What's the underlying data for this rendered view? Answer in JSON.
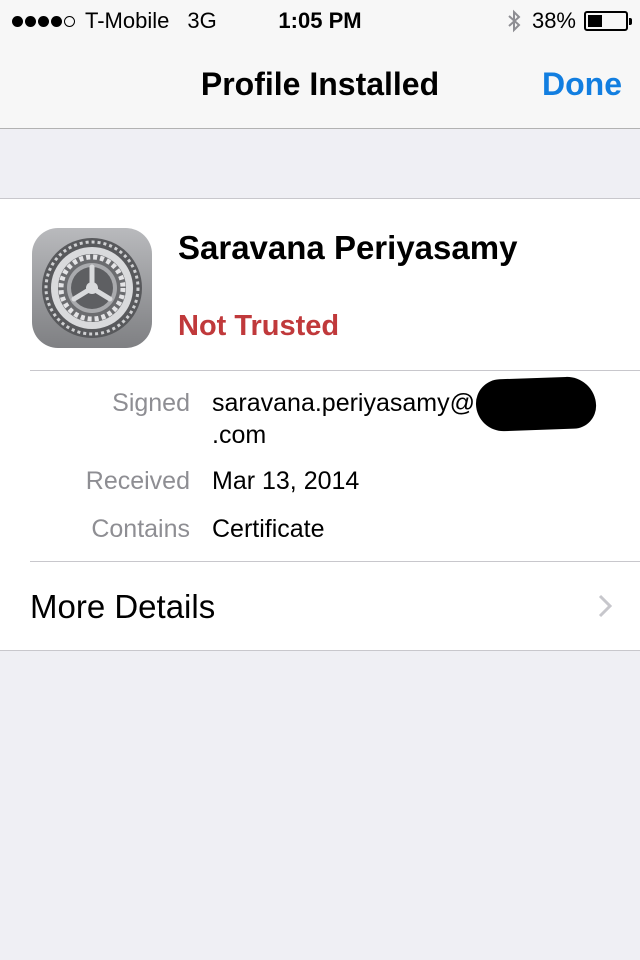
{
  "status_bar": {
    "signal_bars_filled": 4,
    "signal_bars_total": 5,
    "carrier": "T-Mobile",
    "network": "3G",
    "time": "1:05 PM",
    "bluetooth_icon": "bluetooth-icon",
    "battery_percent": "38%",
    "battery_level": 0.38
  },
  "nav": {
    "title": "Profile Installed",
    "done_label": "Done",
    "accent_color": "#127ee0"
  },
  "profile": {
    "icon": "settings-gear-icon",
    "name": "Saravana Periyasamy",
    "trust_status": "Not Trusted",
    "trust_color": "#c0393b",
    "details": {
      "signed_label": "Signed",
      "signed_value_line1": "saravana.periyasamy@",
      "signed_value_line2": ".com",
      "received_label": "Received",
      "received_value": "Mar 13, 2014",
      "contains_label": "Contains",
      "contains_value": "Certificate"
    },
    "more_details_label": "More Details"
  }
}
